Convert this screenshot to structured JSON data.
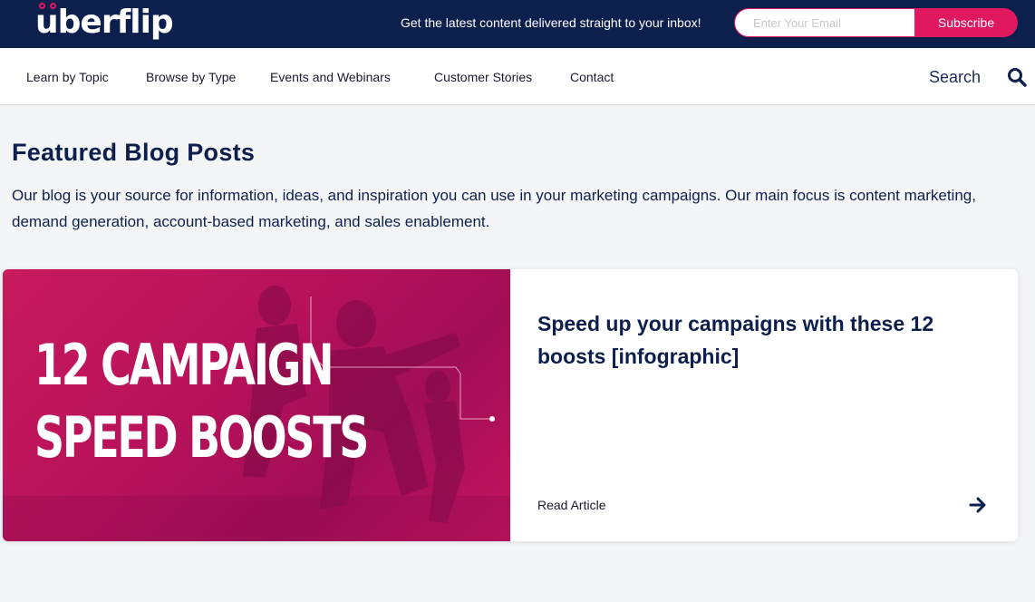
{
  "header": {
    "logo": "uberflip",
    "promo_text": "Get the latest content delivered straight to your inbox!",
    "email_placeholder": "Enter Your Email",
    "subscribe_label": "Subscribe",
    "colors": {
      "brand_navy": "#0c1f4d",
      "accent_pink": "#e0195f"
    }
  },
  "nav": {
    "items": [
      {
        "label": "Learn by Topic"
      },
      {
        "label": "Browse by Type"
      },
      {
        "label": "Events and Webinars"
      },
      {
        "label": "Customer Stories"
      },
      {
        "label": "Contact"
      }
    ],
    "search_label": "Search",
    "search_icon": "search-icon"
  },
  "main": {
    "title": "Featured Blog Posts",
    "description": "Our blog is your source for information, ideas, and inspiration you can use in your marketing campaigns. Our main focus is content marketing, demand generation, account-based marketing, and sales enablement.",
    "featured": {
      "image_text_line1": "12 CAMPAIGN",
      "image_text_line2": "SPEED BOOSTS",
      "title": "Speed up your campaigns with these 12 boosts [infographic]",
      "read_label": "Read Article",
      "arrow_icon": "arrow-right-icon"
    }
  }
}
